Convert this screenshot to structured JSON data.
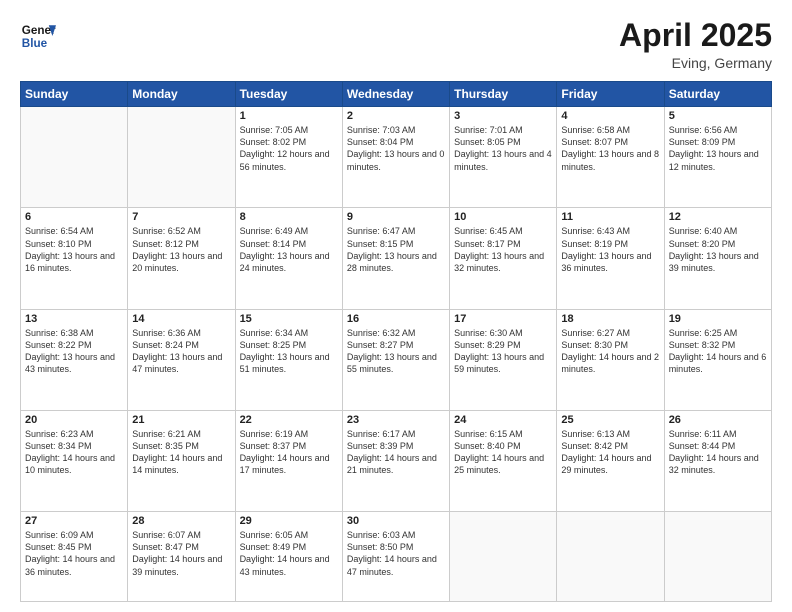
{
  "header": {
    "logo_line1": "General",
    "logo_line2": "Blue",
    "month_year": "April 2025",
    "location": "Eving, Germany"
  },
  "weekdays": [
    "Sunday",
    "Monday",
    "Tuesday",
    "Wednesday",
    "Thursday",
    "Friday",
    "Saturday"
  ],
  "weeks": [
    [
      {
        "day": "",
        "info": ""
      },
      {
        "day": "",
        "info": ""
      },
      {
        "day": "1",
        "info": "Sunrise: 7:05 AM\nSunset: 8:02 PM\nDaylight: 12 hours and 56 minutes."
      },
      {
        "day": "2",
        "info": "Sunrise: 7:03 AM\nSunset: 8:04 PM\nDaylight: 13 hours and 0 minutes."
      },
      {
        "day": "3",
        "info": "Sunrise: 7:01 AM\nSunset: 8:05 PM\nDaylight: 13 hours and 4 minutes."
      },
      {
        "day": "4",
        "info": "Sunrise: 6:58 AM\nSunset: 8:07 PM\nDaylight: 13 hours and 8 minutes."
      },
      {
        "day": "5",
        "info": "Sunrise: 6:56 AM\nSunset: 8:09 PM\nDaylight: 13 hours and 12 minutes."
      }
    ],
    [
      {
        "day": "6",
        "info": "Sunrise: 6:54 AM\nSunset: 8:10 PM\nDaylight: 13 hours and 16 minutes."
      },
      {
        "day": "7",
        "info": "Sunrise: 6:52 AM\nSunset: 8:12 PM\nDaylight: 13 hours and 20 minutes."
      },
      {
        "day": "8",
        "info": "Sunrise: 6:49 AM\nSunset: 8:14 PM\nDaylight: 13 hours and 24 minutes."
      },
      {
        "day": "9",
        "info": "Sunrise: 6:47 AM\nSunset: 8:15 PM\nDaylight: 13 hours and 28 minutes."
      },
      {
        "day": "10",
        "info": "Sunrise: 6:45 AM\nSunset: 8:17 PM\nDaylight: 13 hours and 32 minutes."
      },
      {
        "day": "11",
        "info": "Sunrise: 6:43 AM\nSunset: 8:19 PM\nDaylight: 13 hours and 36 minutes."
      },
      {
        "day": "12",
        "info": "Sunrise: 6:40 AM\nSunset: 8:20 PM\nDaylight: 13 hours and 39 minutes."
      }
    ],
    [
      {
        "day": "13",
        "info": "Sunrise: 6:38 AM\nSunset: 8:22 PM\nDaylight: 13 hours and 43 minutes."
      },
      {
        "day": "14",
        "info": "Sunrise: 6:36 AM\nSunset: 8:24 PM\nDaylight: 13 hours and 47 minutes."
      },
      {
        "day": "15",
        "info": "Sunrise: 6:34 AM\nSunset: 8:25 PM\nDaylight: 13 hours and 51 minutes."
      },
      {
        "day": "16",
        "info": "Sunrise: 6:32 AM\nSunset: 8:27 PM\nDaylight: 13 hours and 55 minutes."
      },
      {
        "day": "17",
        "info": "Sunrise: 6:30 AM\nSunset: 8:29 PM\nDaylight: 13 hours and 59 minutes."
      },
      {
        "day": "18",
        "info": "Sunrise: 6:27 AM\nSunset: 8:30 PM\nDaylight: 14 hours and 2 minutes."
      },
      {
        "day": "19",
        "info": "Sunrise: 6:25 AM\nSunset: 8:32 PM\nDaylight: 14 hours and 6 minutes."
      }
    ],
    [
      {
        "day": "20",
        "info": "Sunrise: 6:23 AM\nSunset: 8:34 PM\nDaylight: 14 hours and 10 minutes."
      },
      {
        "day": "21",
        "info": "Sunrise: 6:21 AM\nSunset: 8:35 PM\nDaylight: 14 hours and 14 minutes."
      },
      {
        "day": "22",
        "info": "Sunrise: 6:19 AM\nSunset: 8:37 PM\nDaylight: 14 hours and 17 minutes."
      },
      {
        "day": "23",
        "info": "Sunrise: 6:17 AM\nSunset: 8:39 PM\nDaylight: 14 hours and 21 minutes."
      },
      {
        "day": "24",
        "info": "Sunrise: 6:15 AM\nSunset: 8:40 PM\nDaylight: 14 hours and 25 minutes."
      },
      {
        "day": "25",
        "info": "Sunrise: 6:13 AM\nSunset: 8:42 PM\nDaylight: 14 hours and 29 minutes."
      },
      {
        "day": "26",
        "info": "Sunrise: 6:11 AM\nSunset: 8:44 PM\nDaylight: 14 hours and 32 minutes."
      }
    ],
    [
      {
        "day": "27",
        "info": "Sunrise: 6:09 AM\nSunset: 8:45 PM\nDaylight: 14 hours and 36 minutes."
      },
      {
        "day": "28",
        "info": "Sunrise: 6:07 AM\nSunset: 8:47 PM\nDaylight: 14 hours and 39 minutes."
      },
      {
        "day": "29",
        "info": "Sunrise: 6:05 AM\nSunset: 8:49 PM\nDaylight: 14 hours and 43 minutes."
      },
      {
        "day": "30",
        "info": "Sunrise: 6:03 AM\nSunset: 8:50 PM\nDaylight: 14 hours and 47 minutes."
      },
      {
        "day": "",
        "info": ""
      },
      {
        "day": "",
        "info": ""
      },
      {
        "day": "",
        "info": ""
      }
    ]
  ]
}
